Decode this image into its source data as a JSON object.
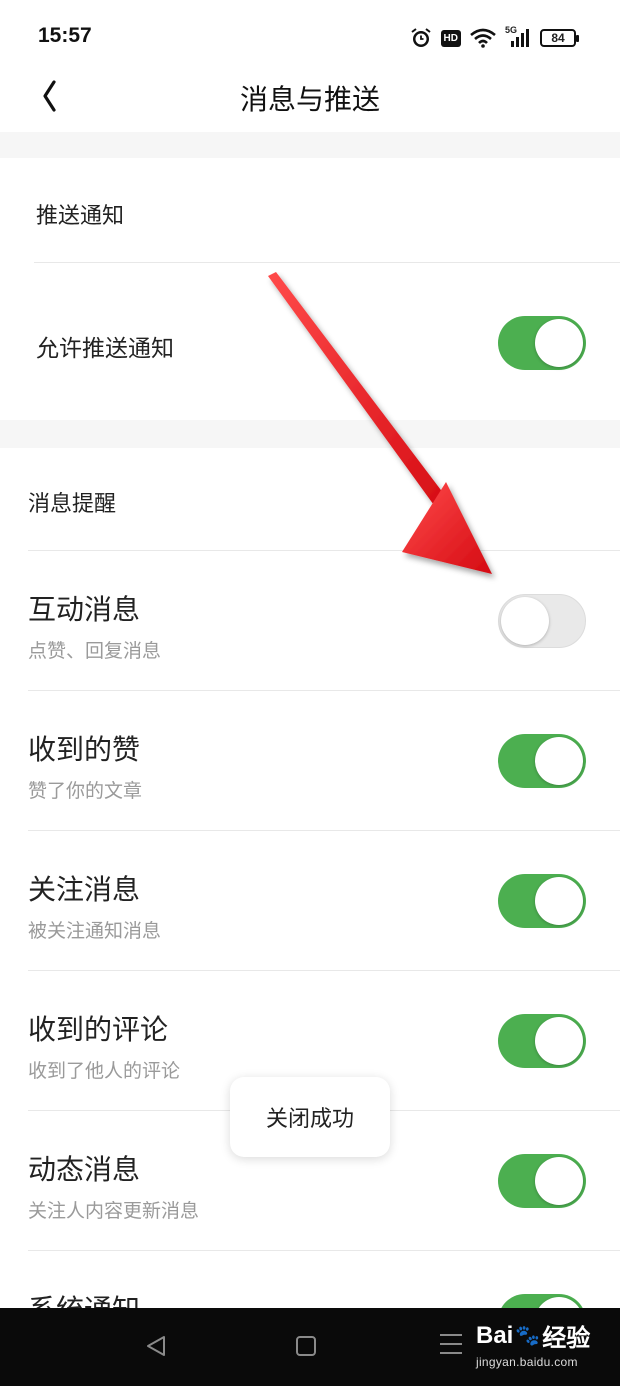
{
  "status_bar": {
    "time": "15:57",
    "hd": "HD",
    "network": "5G",
    "battery": "84"
  },
  "nav": {
    "title": "消息与推送"
  },
  "sections": {
    "push": {
      "header": "推送通知",
      "allow_label": "允许推送通知",
      "allow_on": true
    },
    "reminders": {
      "header": "消息提醒",
      "items": [
        {
          "title": "互动消息",
          "subtitle": "点赞、回复消息",
          "on": false
        },
        {
          "title": "收到的赞",
          "subtitle": "赞了你的文章",
          "on": true
        },
        {
          "title": "关注消息",
          "subtitle": "被关注通知消息",
          "on": true
        },
        {
          "title": "收到的评论",
          "subtitle": "收到了他人的评论",
          "on": true
        },
        {
          "title": "动态消息",
          "subtitle": "关注人内容更新消息",
          "on": true
        },
        {
          "title": "系统通知",
          "subtitle": "",
          "on": true
        }
      ]
    }
  },
  "toast": "关闭成功",
  "watermark": {
    "logo_left": "Bai",
    "logo_right": "经验",
    "url": "jingyan.baidu.com"
  },
  "colors": {
    "toggle_on": "#4caf50",
    "toggle_off": "#e9e9e9",
    "arrow": "#e8141b"
  }
}
